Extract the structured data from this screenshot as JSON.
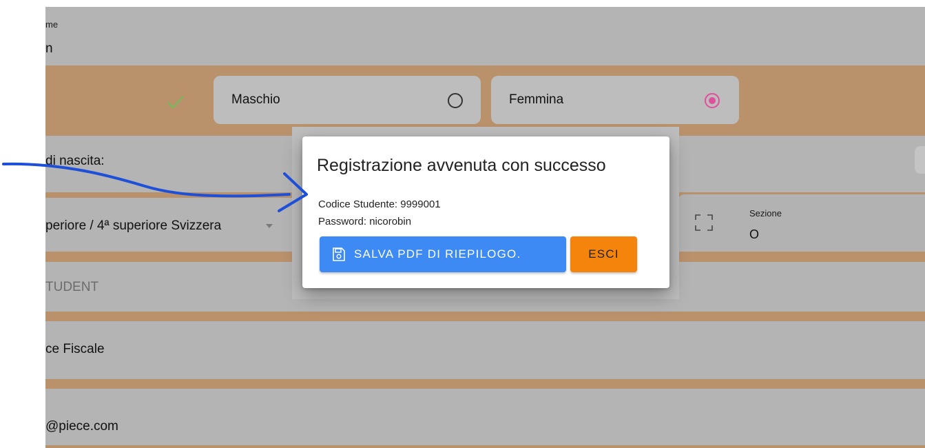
{
  "form": {
    "name_label": "me",
    "name_value": "n",
    "gender": {
      "male_label": "Maschio",
      "female_label": "Femmina"
    },
    "birth_label": "di nascita:",
    "school_value": "periore / 4ª superiore Svizzera",
    "section_label": "Sezione",
    "section_value": "O",
    "student_type": "TUDENT",
    "fiscal_code_label": "ce Fiscale",
    "email_value": "@piece.com"
  },
  "dialog": {
    "title": "Registrazione avvenuta con successo",
    "student_code": "Codice Studente: 9999001",
    "password": "Password: nicorobin",
    "save_button": "SALVA PDF DI RIEPILOGO.",
    "exit_button": "ESCI"
  },
  "colors": {
    "accent_blue": "#3d8af4",
    "accent_orange": "#f5840c",
    "check_green": "#6fbf5a",
    "radio_selected": "#e0509a",
    "annotation_arrow": "#1d4fd8"
  },
  "icons": {
    "check": "check-icon",
    "radio_off": "radio-unchecked-icon",
    "radio_on": "radio-checked-icon",
    "fullscreen": "fullscreen-icon",
    "save": "floppy-disk-icon",
    "dropdown": "caret-down-icon"
  }
}
